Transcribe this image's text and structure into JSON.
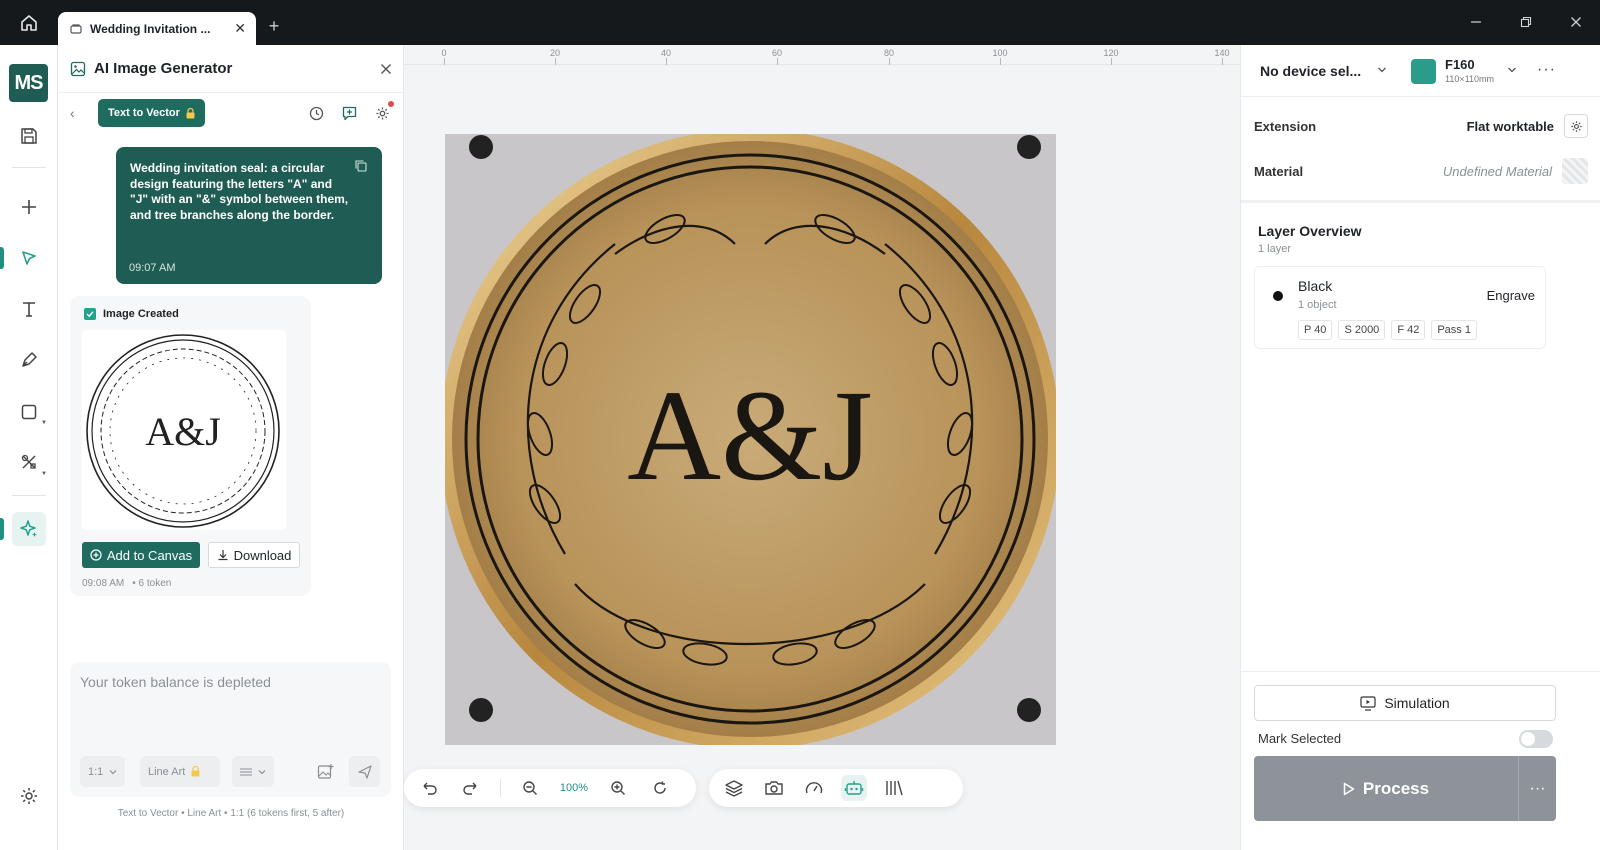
{
  "titlebar": {
    "tab_title": "Wedding Invitation   ...",
    "new_tab": "+"
  },
  "rail": {
    "logo": "MS"
  },
  "ai_panel": {
    "title": "AI Image Generator",
    "mode": "Text to Vector",
    "prompt": "Wedding invitation seal: a circular design featuring the letters \"A\" and \"J\" with an \"&\" symbol between them, and tree branches along the border.",
    "prompt_time": "09:07 AM",
    "created_label": "Image Created",
    "thumb_text": "A&J",
    "add_button": "Add to Canvas",
    "download_button": "Download",
    "result_time": "09:08 AM",
    "result_tokens": "• 6 token",
    "input_placeholder": "Your token balance is depleted",
    "ratio_chip": "1:1",
    "style_chip": "Line Art",
    "footer_note": "Text to Vector • Line Art • 1:1 (6 tokens first, 5 after)"
  },
  "canvas": {
    "ruler_labels": [
      "0",
      "20",
      "40",
      "60",
      "80",
      "100",
      "120",
      "140"
    ],
    "artwork_text": "A&J",
    "zoom": "100%"
  },
  "right_panel": {
    "device": "No device sel...",
    "machine": "F160",
    "machine_size": "110×110mm",
    "extension_label": "Extension",
    "extension_value": "Flat worktable",
    "material_label": "Material",
    "material_value": "Undefined Material",
    "layer_overview_title": "Layer Overview",
    "layer_count": "1 layer",
    "layer": {
      "name": "Black",
      "objects": "1 object",
      "mode": "Engrave",
      "params": [
        "P 40",
        "S 2000",
        "F 42",
        "Pass 1"
      ]
    },
    "simulation": "Simulation",
    "mark_selected": "Mark Selected",
    "process": "Process"
  },
  "colors": {
    "accent": "#1f6b5f",
    "accent_light": "#2a9d8a",
    "titlebar": "#16191c",
    "process_disabled": "#8e9399",
    "brass": "#c9a464"
  }
}
